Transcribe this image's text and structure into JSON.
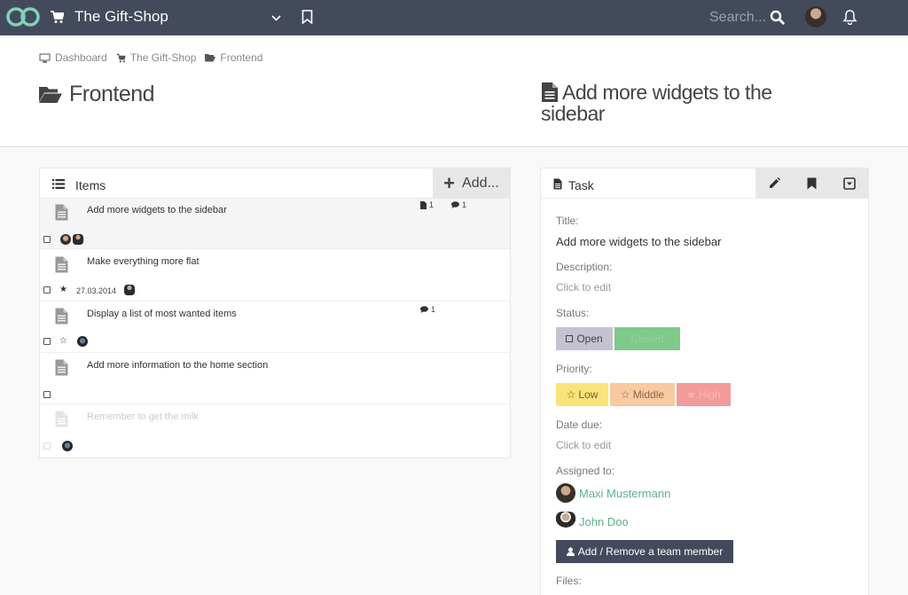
{
  "topbar": {
    "title": "The Gift-Shop",
    "search_placeholder": "Search...",
    "colors": {
      "bar": "#434a5c",
      "logo": "#7fd3b8"
    }
  },
  "breadcrumb": [
    {
      "label": "Dashboard",
      "icon": "monitor-icon"
    },
    {
      "label": "The Gift-Shop",
      "icon": "cart-icon"
    },
    {
      "label": "Frontend",
      "icon": "folder-open-icon"
    }
  ],
  "page": {
    "title": "Frontend",
    "task_heading": "Add more widgets to the sidebar"
  },
  "items_panel": {
    "title": "Items",
    "add_label": "Add...",
    "items": [
      {
        "title": "Add more widgets to the sidebar",
        "files": "1",
        "comments": "1",
        "date": ""
      },
      {
        "title": "Make everything more flat",
        "files": "",
        "comments": "",
        "date": "27.03.2014"
      },
      {
        "title": "Display a list of most wanted items",
        "files": "",
        "comments": "1",
        "date": ""
      },
      {
        "title": "Add more information to the home section",
        "files": "",
        "comments": "",
        "date": ""
      },
      {
        "title": "Remember to get the milk",
        "files": "",
        "comments": "",
        "date": ""
      }
    ]
  },
  "task_panel": {
    "title": "Task",
    "title_label": "Title:",
    "title_value": "Add more widgets to the sidebar",
    "description_label": "Description:",
    "description_value": "Click to edit",
    "status_label": "Status:",
    "status_open": "Open",
    "status_closed": "Closed",
    "priority_label": "Priority:",
    "priority_low": "Low",
    "priority_middle": "Middle",
    "priority_high": "High",
    "date_label": "Date due:",
    "date_value": "Click to edit",
    "assigned_label": "Assigned to:",
    "assignees": [
      "Maxi Mustermann",
      "John Doo"
    ],
    "team_button": "Add / Remove a team member",
    "files_label": "Files:",
    "colors": {
      "open": "#c5c3d1",
      "closed": "#7fc98a",
      "low": "#f8e47a",
      "middle": "#f9c9a0",
      "high": "#f39b9b",
      "link": "#5bb38a"
    }
  }
}
